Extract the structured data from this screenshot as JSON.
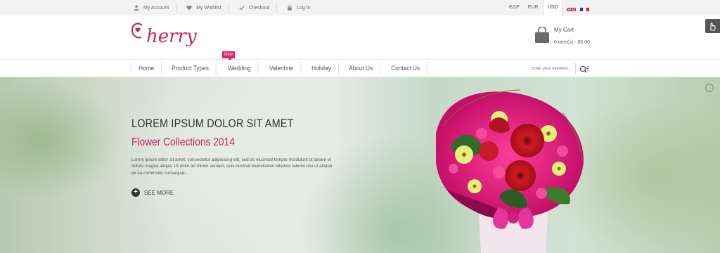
{
  "topbar": {
    "links": [
      {
        "label": "My Account",
        "icon": "user-icon"
      },
      {
        "label": "My Wishlist",
        "icon": "heart-icon"
      },
      {
        "label": "Checkout",
        "icon": "check-icon"
      },
      {
        "label": "Log In",
        "icon": "lock-icon"
      }
    ],
    "currencies": [
      "EGP",
      "EUR",
      "USD"
    ],
    "active_currency": "USD",
    "languages": [
      "English",
      "French"
    ]
  },
  "header": {
    "logo_text": "herry",
    "logo_initial": "C",
    "brand_color": "#c8285f",
    "cart": {
      "title": "My Cart",
      "summary": "0 item(s) - $0.00"
    }
  },
  "nav": {
    "items": [
      "Home",
      "Product Types",
      "Wedding",
      "Valentine",
      "Holiday",
      "About Us",
      "Contact Us"
    ],
    "badge": "New",
    "search_placeholder": "Enter your keyword..."
  },
  "hero": {
    "heading": "LOREM IPSUM DOLOR SIT AMET",
    "subheading": "Flower Collections 2014",
    "body": "Lorem ipsum dolor sit amet, consectetur adipisicing elit, sed do eiusmod tempor incididunt ut labore et dolore magna aliqua. Ut enim ad minim veniam, quis nostrud exercitation ullamco laboris nisi ut aliquip ex ea commodo consequat...",
    "cta": "SEE MORE",
    "accent": "#d01e60"
  }
}
